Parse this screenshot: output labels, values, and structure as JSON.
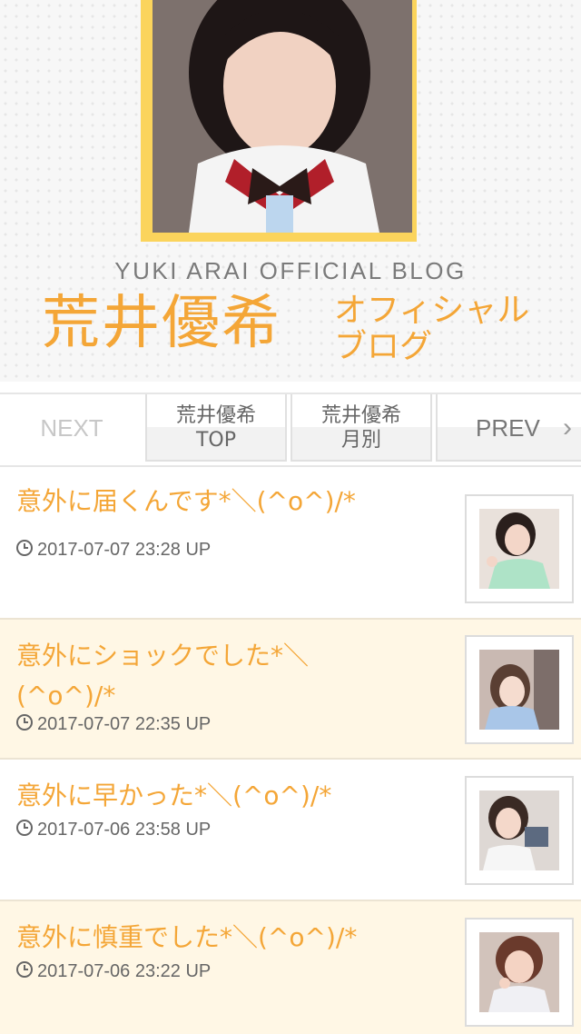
{
  "header": {
    "blog_title_en": "YUKI ARAI OFFICIAL BLOG",
    "blog_title_name": "荒井優希",
    "blog_title_sub_1": "オフィシャル",
    "blog_title_sub_2": "ブログ"
  },
  "nav": {
    "next_label": "NEXT",
    "top_label_1": "荒井優希",
    "top_label_2": "TOP",
    "month_label_1": "荒井優希",
    "month_label_2": "月別",
    "prev_label": "PREV",
    "prev_icon": "chevron-right-icon"
  },
  "posts": [
    {
      "title": "意外に届くんです*＼(^o^)/*",
      "date": "2017-07-07 23:28 UP"
    },
    {
      "title": "意外にショックでした*＼(^o^)/*",
      "date": "2017-07-07 22:35 UP"
    },
    {
      "title": "意外に早かった*＼(^o^)/*",
      "date": "2017-07-06 23:58 UP"
    },
    {
      "title": "意外に慎重でした*＼(^o^)/*",
      "date": "2017-07-06 23:22 UP"
    }
  ],
  "colors": {
    "accent": "#f4a637",
    "frame": "#fbd45c",
    "alt_row": "#fff7e5"
  }
}
